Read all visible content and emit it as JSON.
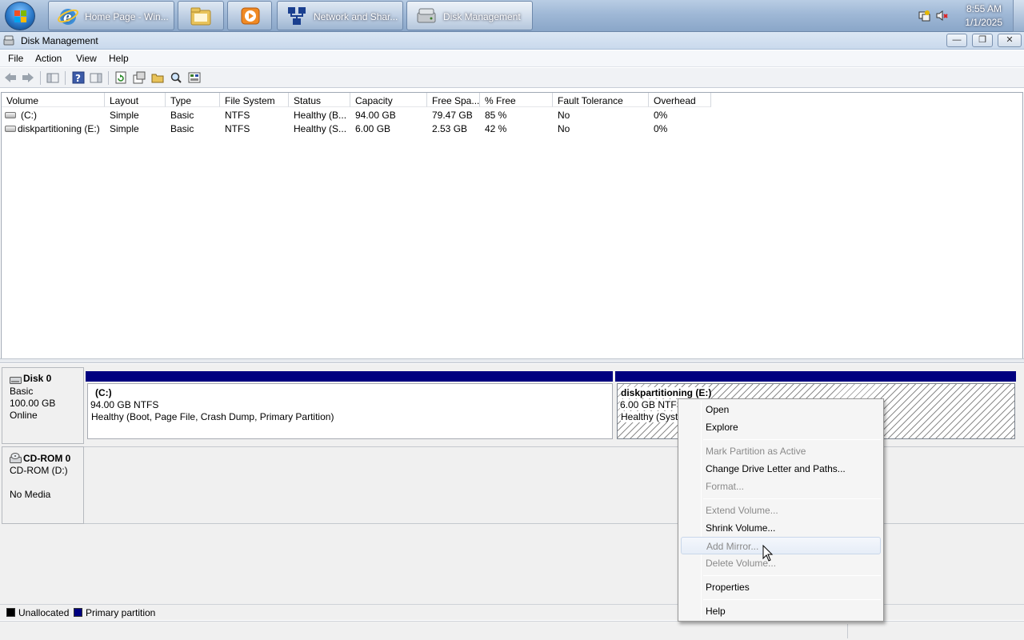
{
  "taskbar": {
    "buttons": [
      {
        "label": "Home Page - Win...",
        "icon": "internet-explorer-icon"
      },
      {
        "label": "",
        "icon": "windows-explorer-icon"
      },
      {
        "label": "",
        "icon": "media-player-icon"
      },
      {
        "label": "Network and Shar...",
        "icon": "network-icon"
      },
      {
        "label": "Disk Management",
        "icon": "disk-management-icon"
      }
    ],
    "clock_time": "8:55 AM",
    "clock_date": "1/1/2025"
  },
  "window": {
    "title": "Disk Management",
    "controls": {
      "minimize": "—",
      "restore": "❐",
      "close": "✕"
    }
  },
  "menubar": {
    "items": [
      "File",
      "Action",
      "View",
      "Help"
    ]
  },
  "volume_table": {
    "columns": [
      "Volume",
      "Layout",
      "Type",
      "File System",
      "Status",
      "Capacity",
      "Free Spa...",
      "% Free",
      "Fault Tolerance",
      "Overhead"
    ],
    "rows": [
      {
        "volume": "(C:)",
        "layout": "Simple",
        "type": "Basic",
        "fs": "NTFS",
        "status": "Healthy (B...",
        "capacity": "94.00 GB",
        "free": "79.47 GB",
        "pct_free": "85 %",
        "fault": "No",
        "overhead": "0%"
      },
      {
        "volume": "diskpartitioning (E:)",
        "layout": "Simple",
        "type": "Basic",
        "fs": "NTFS",
        "status": "Healthy (S...",
        "capacity": "6.00 GB",
        "free": "2.53 GB",
        "pct_free": "42 %",
        "fault": "No",
        "overhead": "0%"
      }
    ]
  },
  "disks": {
    "disk0": {
      "name": "Disk 0",
      "type": "Basic",
      "size": "100.00 GB",
      "state": "Online"
    },
    "cdrom0": {
      "name": "CD-ROM 0",
      "type": "CD-ROM (D:)",
      "state": "No Media"
    }
  },
  "partitions": {
    "c": {
      "name": "(C:)",
      "size": "94.00 GB NTFS",
      "status": "Healthy (Boot, Page File, Crash Dump, Primary Partition)"
    },
    "e": {
      "name": "diskpartitioning  (E:)",
      "size": "6.00 GB NTFS",
      "status": "Healthy (Syste"
    }
  },
  "legend": {
    "unallocated": "Unallocated",
    "primary": "Primary partition",
    "unallocated_color": "#000000",
    "primary_color": "#000080"
  },
  "context_menu": {
    "open": "Open",
    "explore": "Explore",
    "mark_active": "Mark Partition as Active",
    "change_letter": "Change Drive Letter and Paths...",
    "format": "Format...",
    "extend": "Extend Volume...",
    "shrink": "Shrink Volume...",
    "add_mirror": "Add Mirror...",
    "delete": "Delete Volume...",
    "properties": "Properties",
    "help": "Help"
  }
}
